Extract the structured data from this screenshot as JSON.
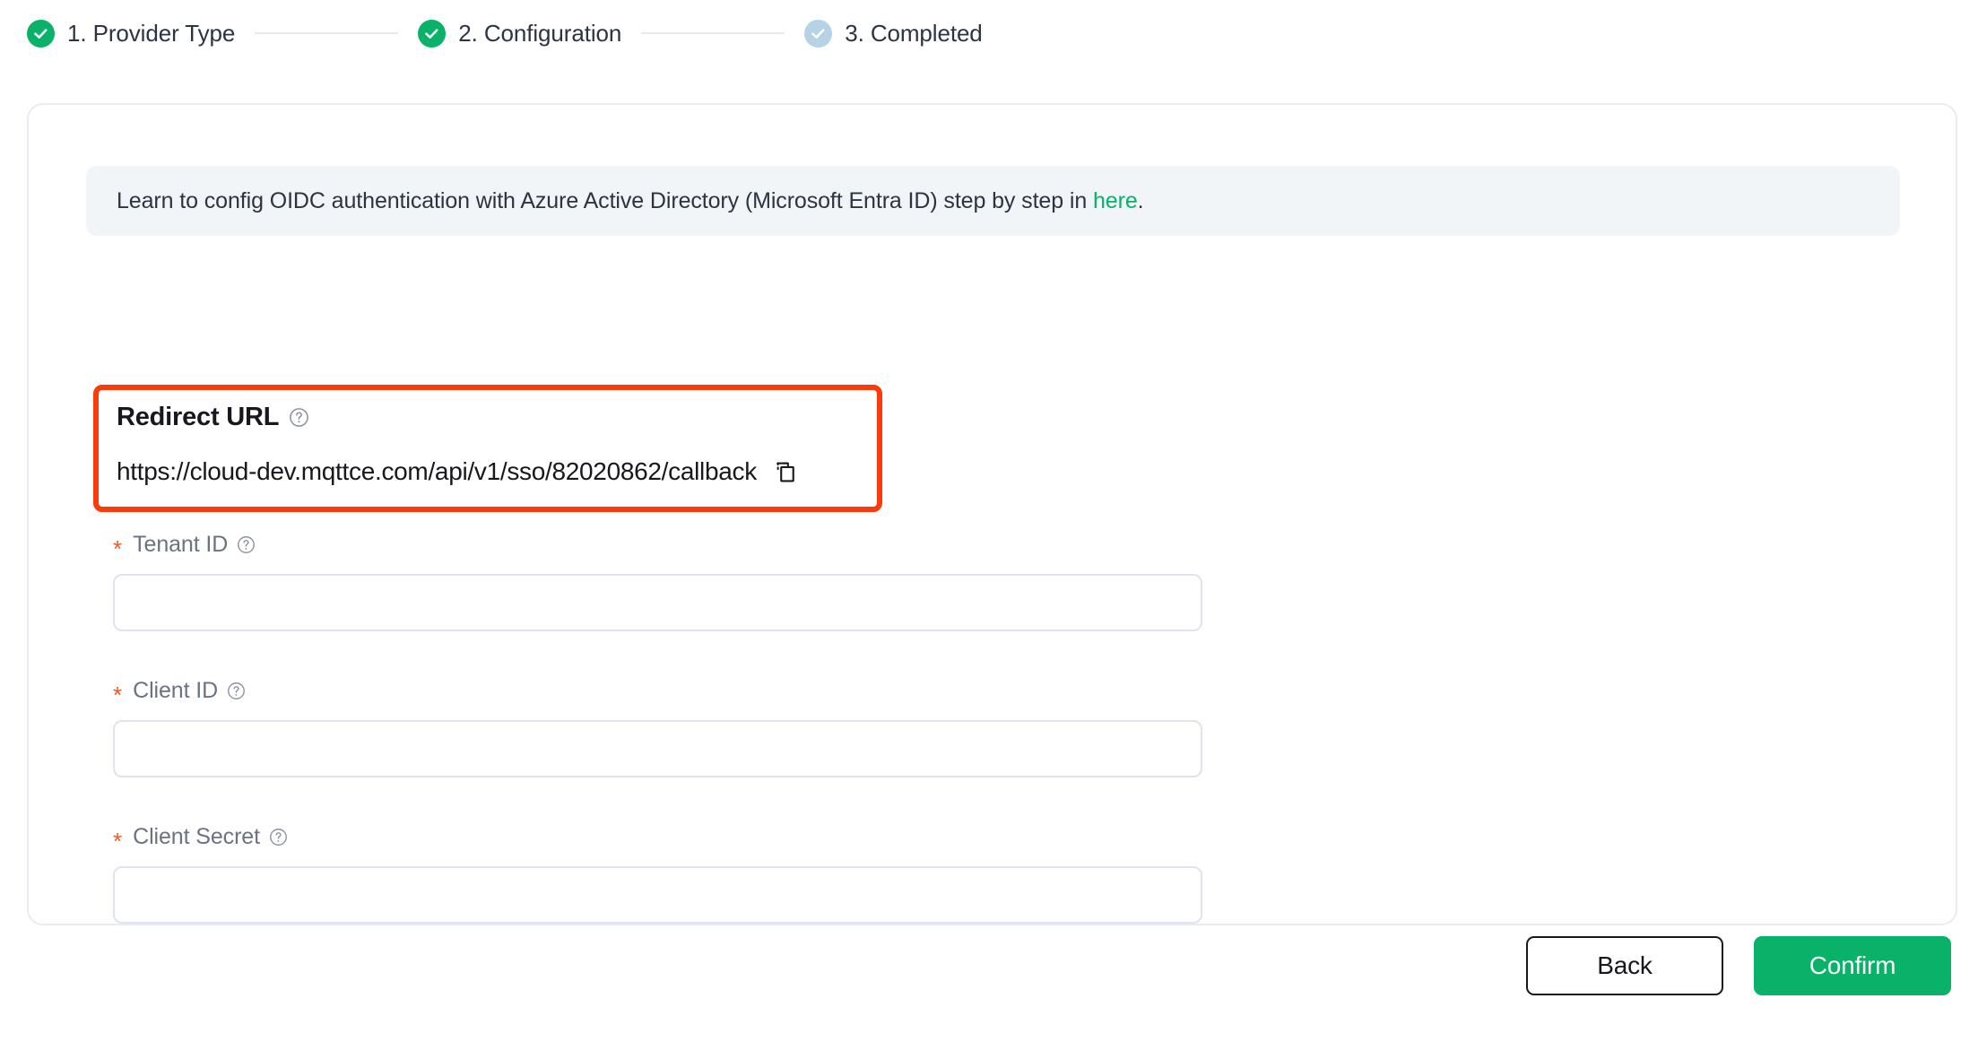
{
  "stepper": {
    "steps": [
      {
        "label": "1. Provider Type",
        "state": "done",
        "icon": "check-circle-icon"
      },
      {
        "label": "2. Configuration",
        "state": "done",
        "icon": "check-circle-icon"
      },
      {
        "label": "3. Completed",
        "state": "pending",
        "icon": "check-circle-icon"
      }
    ]
  },
  "banner": {
    "text_before": "Learn to config OIDC authentication with Azure Active Directory (Microsoft Entra ID) step by step in ",
    "link_text": "here",
    "text_after": "."
  },
  "redirect": {
    "title": "Redirect URL",
    "help_icon": "question-circle-icon",
    "url": "https://cloud-dev.mqttce.com/api/v1/sso/82020862/callback",
    "copy_icon": "copy-icon",
    "highlight_color": "#fc3b0a"
  },
  "form": {
    "fields": [
      {
        "label": "Tenant ID",
        "required_marker": "*",
        "help_icon": "question-circle-icon",
        "value": "",
        "placeholder": ""
      },
      {
        "label": "Client ID",
        "required_marker": "*",
        "help_icon": "question-circle-icon",
        "value": "",
        "placeholder": ""
      },
      {
        "label": "Client Secret",
        "required_marker": "*",
        "help_icon": "question-circle-icon",
        "value": "",
        "placeholder": ""
      }
    ]
  },
  "footer": {
    "back_label": "Back",
    "confirm_label": "Confirm"
  },
  "colors": {
    "accent_green": "#09b268",
    "pending_blue": "#b6d3e6",
    "required_orange": "#fa541c",
    "highlight_red": "#fc3b0a",
    "banner_bg": "#f2f5f7",
    "border": "#e8ecf2"
  }
}
